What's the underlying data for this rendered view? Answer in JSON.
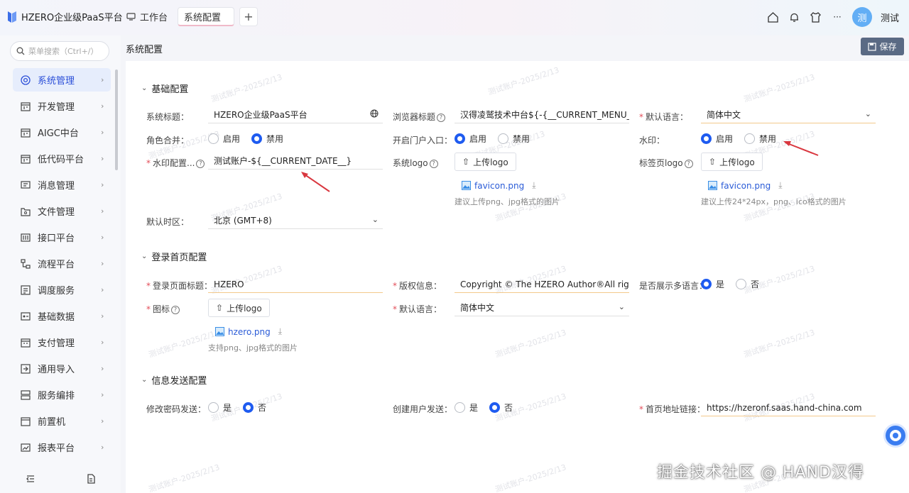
{
  "app": {
    "title": "HZERO企业级PaaS平台"
  },
  "tabs": [
    {
      "label": "工作台"
    },
    {
      "label": "系统配置"
    }
  ],
  "user": {
    "avatar_text": "测",
    "name": "测试"
  },
  "search": {
    "placeholder": "菜单搜索（Ctrl+/）"
  },
  "menu": [
    {
      "label": "系统管理",
      "icon": "settings-icon"
    },
    {
      "label": "开发管理",
      "icon": "calendar-icon"
    },
    {
      "label": "AIGC中台",
      "icon": "calendar-icon"
    },
    {
      "label": "低代码平台",
      "icon": "calendar-icon"
    },
    {
      "label": "消息管理",
      "icon": "message-icon"
    },
    {
      "label": "文件管理",
      "icon": "folder-icon"
    },
    {
      "label": "接口平台",
      "icon": "api-icon"
    },
    {
      "label": "流程平台",
      "icon": "flow-icon"
    },
    {
      "label": "调度服务",
      "icon": "schedule-icon"
    },
    {
      "label": "基础数据",
      "icon": "data-icon"
    },
    {
      "label": "支付管理",
      "icon": "payment-icon"
    },
    {
      "label": "通用导入",
      "icon": "import-icon"
    },
    {
      "label": "服务编排",
      "icon": "orchestration-icon"
    },
    {
      "label": "前置机",
      "icon": "server-icon"
    },
    {
      "label": "报表平台",
      "icon": "report-icon"
    }
  ],
  "page": {
    "title": "系统配置",
    "save_label": "保存"
  },
  "watermark": "测试账户-2025/2/13",
  "sections": {
    "basic": "基础配置",
    "login": "登录首页配置",
    "message": "信息发送配置"
  },
  "basic": {
    "sys_title_label": "系统标题：",
    "sys_title_value": "HZERO企业级PaaS平台",
    "browser_title_label": "浏览器标题",
    "browser_title_value": "汉得凌鹫技术中台${-{__CURRENT_MENU_",
    "default_lang_label": "默认语言：",
    "default_lang_value": "简体中文",
    "role_merge_label": "角色合并：",
    "enable": "启用",
    "disable": "禁用",
    "portal_label": "开启门户入口：",
    "watermark_label": "水印：",
    "watermark_cfg_label": "水印配置...",
    "watermark_cfg_value": "测试账户-${__CURRENT_DATE__}",
    "sys_logo_label": "系统logo",
    "upload_logo": "上传logo",
    "favicon_file": "favicon.png",
    "sys_logo_hint": "建议上传png、jpg格式的图片",
    "tab_logo_label": "标签页logo",
    "tab_logo_hint": "建议上传24*24px，png、ico格式的图片",
    "timezone_label": "默认时区：",
    "timezone_value": "北京 (GMT+8)"
  },
  "login": {
    "login_title_label": "登录页面标题：",
    "login_title_value": "HZERO",
    "copyright_label": "版权信息：",
    "copyright_value": "Copyright © The HZERO Author®All rights r",
    "multi_lang_label": "是否展示多语言：",
    "yes": "是",
    "no": "否",
    "icon_label": "图标",
    "upload_logo": "上传logo",
    "icon_file": "hzero.png",
    "icon_hint": "支持png、jpg格式的图片",
    "default_lang_label": "默认语言：",
    "default_lang_value": "简体中文"
  },
  "message": {
    "pwd_label": "修改密码发送：",
    "yes": "是",
    "no": "否",
    "create_user_label": "创建用户发送：",
    "home_link_label": "首页地址链接：",
    "home_link_value": "https://hzeronf.saas.hand-china.com"
  },
  "footer": {
    "mark": "掘金技术社区 @ HAND汉得"
  },
  "colors": {
    "primary": "#1e5bf0",
    "required": "#e34d59",
    "annotation_arrow": "#d9373f"
  }
}
